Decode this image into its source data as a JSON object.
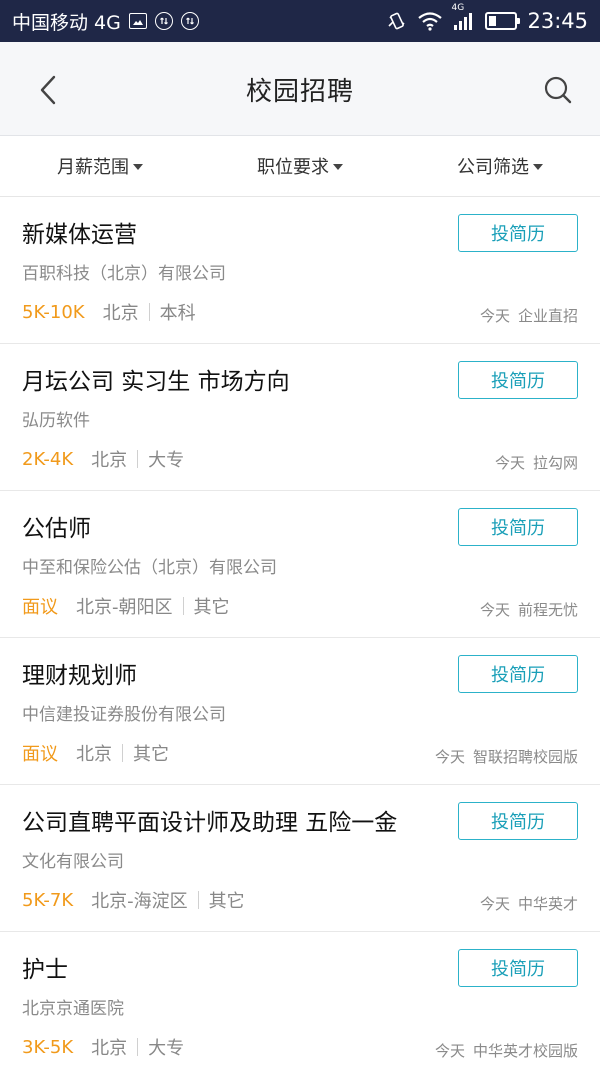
{
  "status_bar": {
    "carrier": "中国移动 4G",
    "network_badge": "4G",
    "time": "23:45",
    "icons": [
      "image-icon",
      "sync-icon",
      "sync-icon",
      "vibrate-icon",
      "wifi-icon",
      "signal-icon",
      "battery-icon"
    ]
  },
  "header": {
    "title": "校园招聘",
    "back_icon": "chevron-left-icon",
    "search_icon": "search-icon"
  },
  "filters": [
    {
      "label": "月薪范围"
    },
    {
      "label": "职位要求"
    },
    {
      "label": "公司筛选"
    }
  ],
  "jobs": [
    {
      "title": "新媒体运营",
      "company": "百职科技（北京）有限公司",
      "salary": "5K-10K",
      "location": "北京",
      "requirement": "本科",
      "date": "今天",
      "source": "企业直招",
      "apply_label": "投简历"
    },
    {
      "title": "月坛公司 实习生 市场方向",
      "company": "弘历软件",
      "salary": "2K-4K",
      "location": "北京",
      "requirement": "大专",
      "date": "今天",
      "source": "拉勾网",
      "apply_label": "投简历"
    },
    {
      "title": "公估师",
      "company": "中至和保险公估（北京）有限公司",
      "salary": "面议",
      "location": "北京-朝阳区",
      "requirement": "其它",
      "date": "今天",
      "source": "前程无忧",
      "apply_label": "投简历"
    },
    {
      "title": "理财规划师",
      "company": "中信建投证券股份有限公司",
      "salary": "面议",
      "location": "北京",
      "requirement": "其它",
      "date": "今天",
      "source": "智联招聘校园版",
      "apply_label": "投简历"
    },
    {
      "title": "公司直聘平面设计师及助理 五险一金",
      "company": "文化有限公司",
      "salary": "5K-7K",
      "location": "北京-海淀区",
      "requirement": "其它",
      "date": "今天",
      "source": "中华英才",
      "apply_label": "投简历"
    },
    {
      "title": "护士",
      "company": "北京京通医院",
      "salary": "3K-5K",
      "location": "北京",
      "requirement": "大专",
      "date": "今天",
      "source": "中华英才校园版",
      "apply_label": "投简历"
    }
  ],
  "colors": {
    "status_bar_bg": "#1f2747",
    "accent": "#2cb2c9",
    "salary": "#f19a1b"
  }
}
